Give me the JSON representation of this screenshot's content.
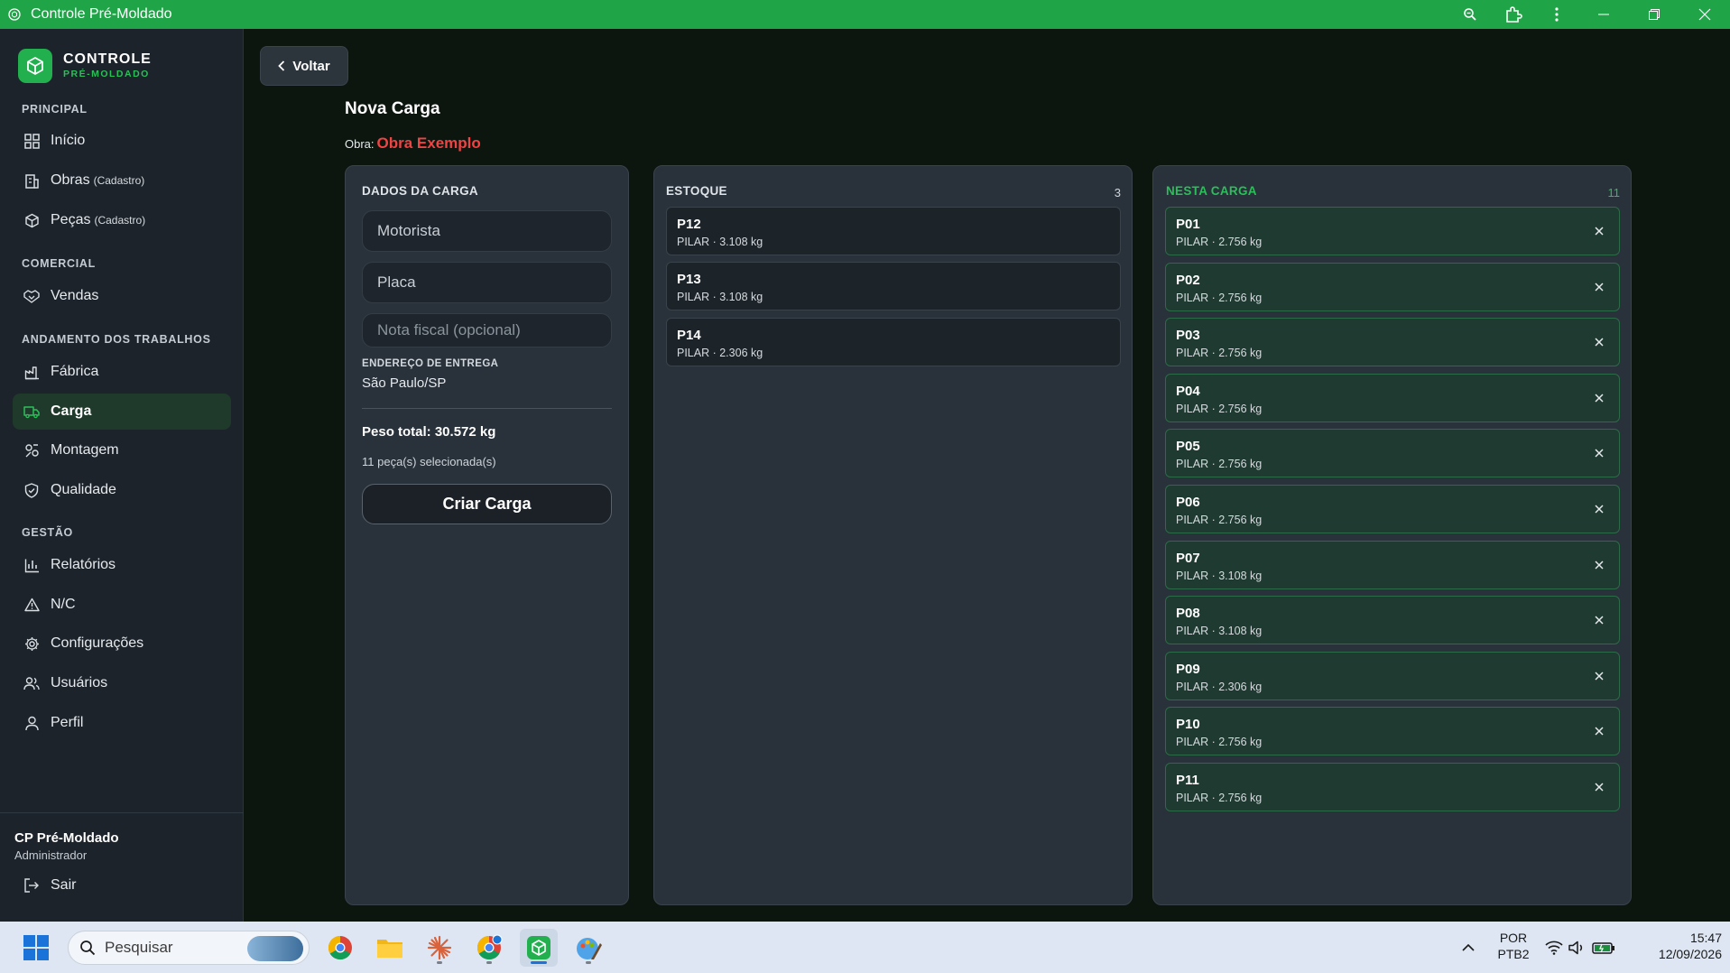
{
  "window": {
    "title": "Controle Pré-Moldado"
  },
  "brand": {
    "title": "CONTROLE",
    "subtitle": "PRÉ-MOLDADO"
  },
  "sidebar": {
    "sections": {
      "principal": "PRINCIPAL",
      "comercial": "COMERCIAL",
      "andamento": "ANDAMENTO DOS TRABALHOS",
      "gestao": "GESTÃO"
    },
    "items": {
      "inicio": {
        "label": "Início",
        "icon": "grid-icon"
      },
      "obras": {
        "label": "Obras",
        "suffix": "(Cadastro)",
        "icon": "building-icon"
      },
      "pecas": {
        "label": "Peças",
        "suffix": "(Cadastro)",
        "icon": "box-icon"
      },
      "vendas": {
        "label": "Vendas",
        "icon": "handshake-icon"
      },
      "fabrica": {
        "label": "Fábrica",
        "icon": "factory-icon"
      },
      "carga": {
        "label": "Carga",
        "icon": "truck-icon",
        "active": true
      },
      "montagem": {
        "label": "Montagem",
        "icon": "crane-icon"
      },
      "qualidade": {
        "label": "Qualidade",
        "icon": "shield-check-icon"
      },
      "relatorios": {
        "label": "Relatórios",
        "icon": "bar-chart-icon"
      },
      "nc": {
        "label": "N/C",
        "icon": "warning-icon"
      },
      "configuracoes": {
        "label": "Configurações",
        "icon": "gear-icon"
      },
      "usuarios": {
        "label": "Usuários",
        "icon": "users-icon"
      },
      "perfil": {
        "label": "Perfil",
        "icon": "user-icon"
      }
    },
    "user": {
      "name": "CP Pré-Moldado",
      "role": "Administrador"
    },
    "logout_label": "Sair"
  },
  "page": {
    "back_label": "Voltar",
    "title": "Nova Carga",
    "obra_label": "Obra:",
    "obra_name": "Obra Exemplo"
  },
  "form": {
    "heading": "DADOS DA CARGA",
    "motorista_placeholder": "Motorista",
    "placa_placeholder": "Placa",
    "nota_placeholder": "Nota fiscal (opcional)",
    "address_label": "ENDEREÇO DE ENTREGA",
    "address_value": "São Paulo/SP",
    "peso_total": "Peso total: 30.572 kg",
    "selected_count": "11 peça(s) selecionada(s)",
    "submit_label": "Criar Carga"
  },
  "estoque": {
    "heading": "ESTOQUE",
    "count": "3",
    "items": [
      {
        "id": "P12",
        "info": "PILAR · 3.108 kg"
      },
      {
        "id": "P13",
        "info": "PILAR · 3.108 kg"
      },
      {
        "id": "P14",
        "info": "PILAR · 2.306 kg"
      }
    ]
  },
  "nesta_carga": {
    "heading": "NESTA CARGA",
    "count": "11",
    "items": [
      {
        "id": "P01",
        "info": "PILAR · 2.756 kg"
      },
      {
        "id": "P02",
        "info": "PILAR · 2.756 kg"
      },
      {
        "id": "P03",
        "info": "PILAR · 2.756 kg"
      },
      {
        "id": "P04",
        "info": "PILAR · 2.756 kg"
      },
      {
        "id": "P05",
        "info": "PILAR · 2.756 kg"
      },
      {
        "id": "P06",
        "info": "PILAR · 2.756 kg"
      },
      {
        "id": "P07",
        "info": "PILAR · 3.108 kg"
      },
      {
        "id": "P08",
        "info": "PILAR · 3.108 kg"
      },
      {
        "id": "P09",
        "info": "PILAR · 2.306 kg"
      },
      {
        "id": "P10",
        "info": "PILAR · 2.756 kg"
      },
      {
        "id": "P11",
        "info": "PILAR · 2.756 kg"
      }
    ]
  },
  "taskbar": {
    "search_placeholder": "Pesquisar",
    "lang_top": "POR",
    "lang_bottom": "PTB2",
    "time": "15:47",
    "date": "12/09/2026"
  },
  "colors": {
    "accent": "#22b04f",
    "titlebar": "#1fa547",
    "obra_name": "#ef4444",
    "sidebar_bg": "#1c232a",
    "panel_bg": "#29313a"
  }
}
